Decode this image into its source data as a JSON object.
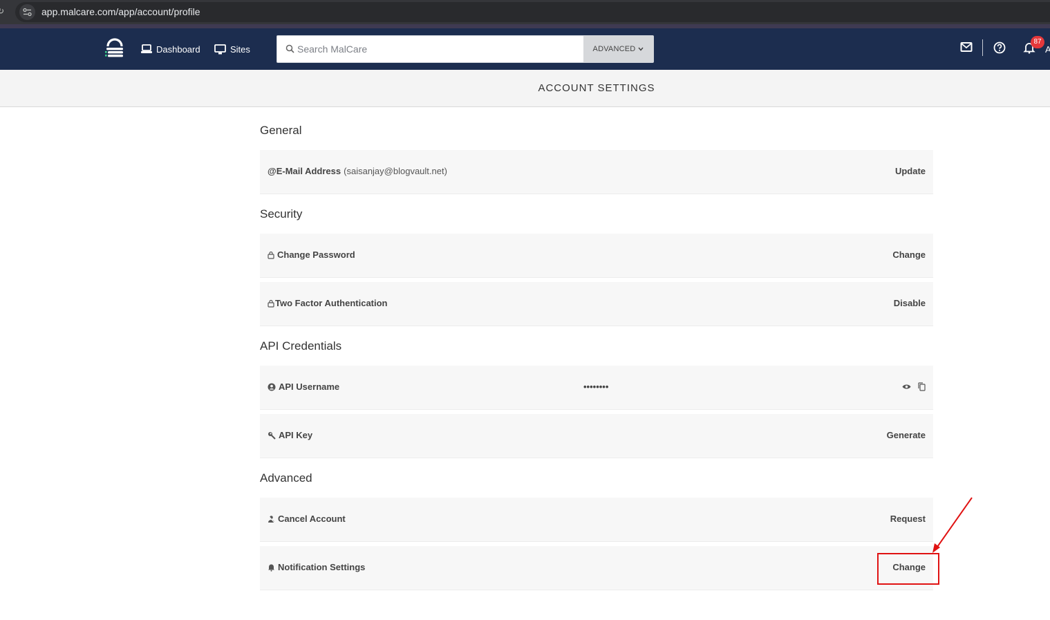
{
  "browser": {
    "url": "app.malcare.com/app/account/profile"
  },
  "header": {
    "nav": {
      "dashboard_label": "Dashboard",
      "sites_label": "Sites"
    },
    "search": {
      "placeholder": "Search MalCare",
      "advanced_label": "ADVANCED"
    },
    "notification_count": "87",
    "truncated_text": "A"
  },
  "page": {
    "title": "ACCOUNT SETTINGS"
  },
  "sections": {
    "general": {
      "heading": "General",
      "email_label": "E-Mail Address",
      "email_value": "saisanjay@blogvault.net",
      "email_action": "Update"
    },
    "security": {
      "heading": "Security",
      "password_label": "Change Password",
      "password_action": "Change",
      "twofa_label": "Two Factor Authentication",
      "twofa_action": "Disable"
    },
    "api": {
      "heading": "API Credentials",
      "username_label": "API Username",
      "username_masked": "••••••••",
      "key_label": "API Key",
      "key_action": "Generate"
    },
    "advanced": {
      "heading": "Advanced",
      "cancel_label": "Cancel Account",
      "cancel_action": "Request",
      "notify_label": "Notification Settings",
      "notify_action": "Change"
    }
  },
  "colors": {
    "header_bg": "#1c2d4f",
    "badge": "#e5383b",
    "annotation": "#e01212"
  }
}
